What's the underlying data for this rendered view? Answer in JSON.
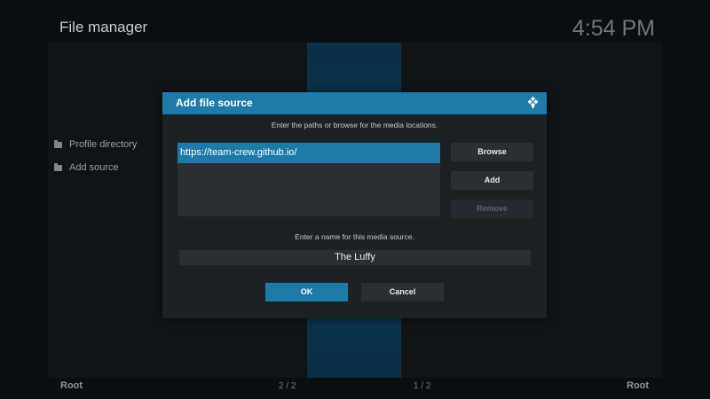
{
  "header": {
    "title": "File manager",
    "clock": "4:54 PM"
  },
  "sidebar": {
    "items": [
      {
        "label": "Profile directory",
        "icon": "folder-icon"
      },
      {
        "label": "Add source",
        "icon": "folder-icon"
      }
    ]
  },
  "footer": {
    "left_label": "Root",
    "left_count": "2 / 2",
    "right_count": "1 / 2",
    "right_label": "Root"
  },
  "dialog": {
    "title": "Add file source",
    "logo": "kodi-logo-icon",
    "paths_instruction": "Enter the paths or browse for the media locations.",
    "paths": [
      "https://team-crew.github.io/"
    ],
    "browse_label": "Browse",
    "add_label": "Add",
    "remove_label": "Remove",
    "name_instruction": "Enter a name for this media source.",
    "name_value": "The Luffy",
    "ok_label": "OK",
    "cancel_label": "Cancel"
  },
  "colors": {
    "accent": "#1e7aa8",
    "background": "#0b0e11",
    "dialog_background": "#1c2126"
  }
}
